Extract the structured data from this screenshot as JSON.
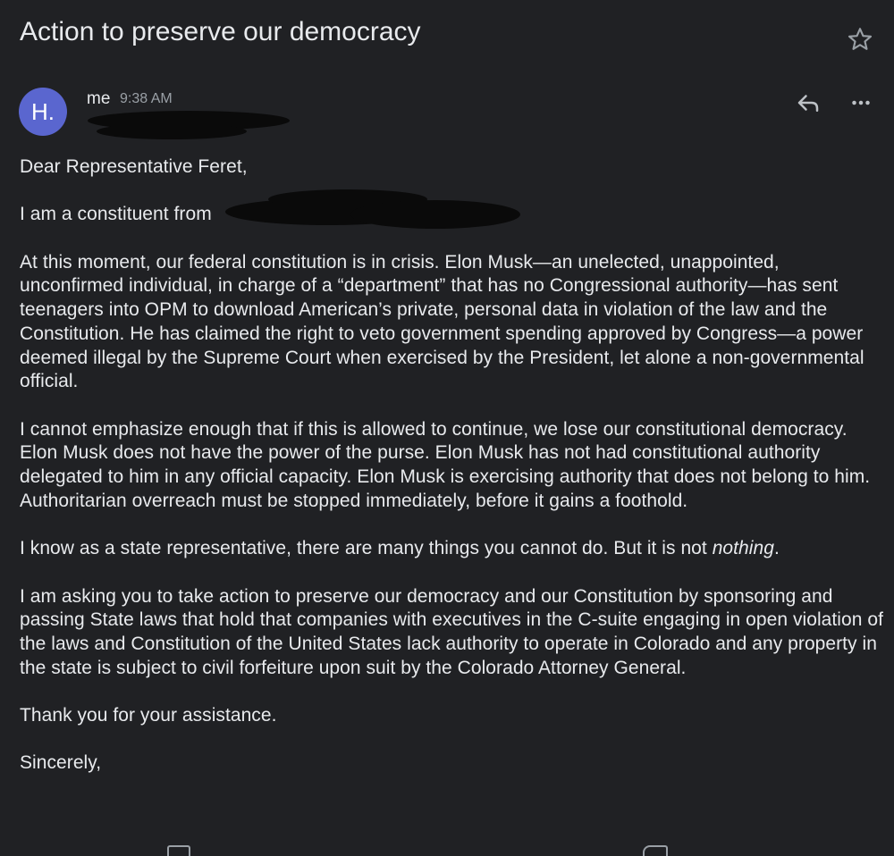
{
  "email": {
    "subject": "Action to preserve our democracy",
    "sender": "me",
    "time": "9:38 AM",
    "avatar_initial": "H.",
    "avatar_color": "#5a66cf",
    "body": {
      "greeting": "Dear Representative Feret,",
      "constituent_line": "I am a constituent from",
      "paragraph1": "At this moment, our federal constitution is in crisis. Elon Musk—an unelected, unappointed, unconfirmed individual, in charge of a “department” that has no Congressional authority—has sent teenagers into OPM to download American’s private, personal data in violation of the law and the Constitution. He has claimed the right to veto government spending approved by Congress—a power deemed illegal by the Supreme Court when exercised by the President, let alone a non-governmental official.",
      "paragraph2": "I cannot emphasize enough that if this is allowed to continue, we lose our constitutional democracy. Elon Musk does not have the power of the purse. Elon Musk has not had constitutional authority delegated to him in any official capacity. Elon Musk is exercising authority that does not belong to him. Authoritarian overreach must be stopped immediately, before it gains a foothold.",
      "paragraph3_start": "I know as a state representative, there are many things you cannot do. But it is not ",
      "paragraph3_emphasis": "nothing",
      "paragraph3_end": ".",
      "paragraph4": "I am asking you to take action to preserve our democracy and our Constitution by sponsoring and passing State laws that hold that companies with executives in the C-suite engaging in open violation of the laws and Constitution of the United States lack authority to operate in Colorado and any property in the state is subject to civil forfeiture upon suit by the Colorado Attorney General.",
      "thanks": "Thank you for your assistance.",
      "closing": "Sincerely,"
    }
  },
  "icons": {
    "star": "star-icon",
    "reply": "reply-icon",
    "more": "more-options-icon"
  },
  "colors": {
    "background": "#202124",
    "text": "#e8eaed",
    "muted": "#9aa0a6"
  }
}
